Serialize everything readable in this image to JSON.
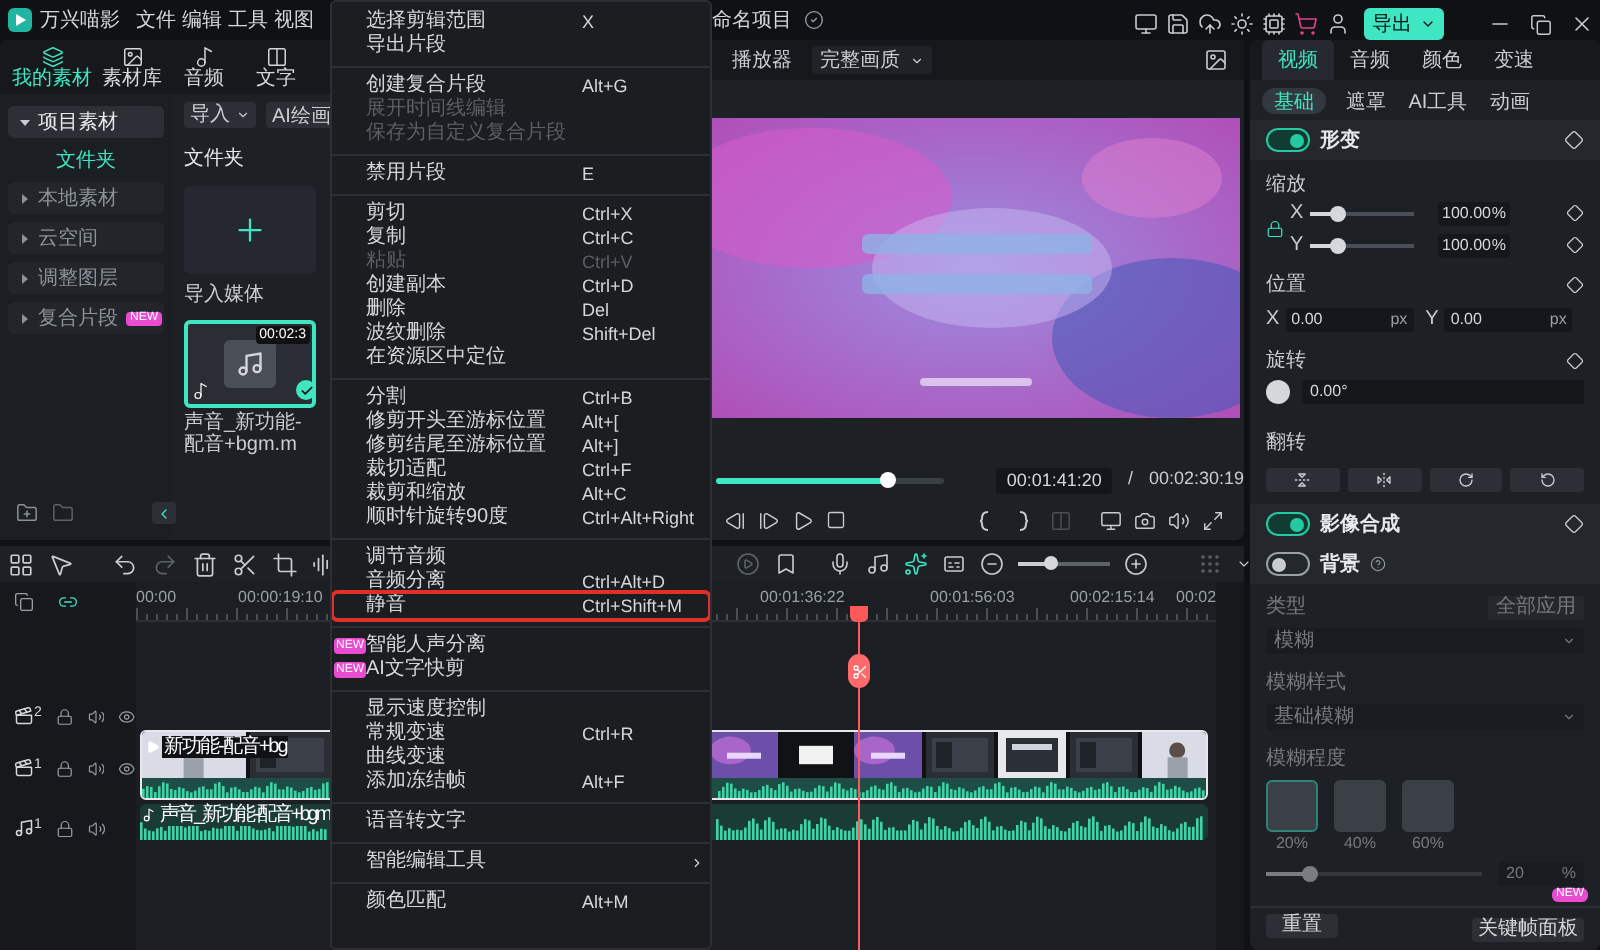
{
  "title_bar": {
    "app_name": "万兴喵影",
    "menus": [
      "文件",
      "编辑",
      "工具",
      "视图"
    ],
    "project_name": "命名项目",
    "export_button": "导出"
  },
  "media_panel": {
    "tabs": [
      {
        "label": "我的素材",
        "selected": true
      },
      {
        "label": "素材库",
        "selected": false
      },
      {
        "label": "音频",
        "selected": false
      },
      {
        "label": "文字",
        "selected": false
      }
    ],
    "sidebar": [
      {
        "label": "项目素材",
        "selected": true,
        "expanded": true,
        "children": [
          {
            "label": "文件夹",
            "selected": true
          }
        ]
      },
      {
        "label": "本地素材",
        "selected": false,
        "expanded": false
      },
      {
        "label": "云空间",
        "selected": false,
        "expanded": false
      },
      {
        "label": "调整图层",
        "selected": false,
        "expanded": false
      },
      {
        "label": "复合片段",
        "selected": false,
        "expanded": false,
        "badge": "NEW"
      }
    ],
    "import_button": "导入",
    "ai_paint_button": "AI绘画",
    "folder_title": "文件夹",
    "import_tile": "导入媒体",
    "clip": {
      "duration": "00:02:3",
      "name": "声音_新功能-配音+bgm.m"
    }
  },
  "player": {
    "label": "播放器",
    "quality": "完整画质",
    "progress": {
      "level": 0.75
    },
    "current_time": "00:01:41:20",
    "divider": "/",
    "total_time": "00:02:30:19"
  },
  "context_menu": {
    "items": [
      {
        "kind": "item",
        "label": "选择剪辑范围",
        "shortcut": "X",
        "disabled": false,
        "selected": false,
        "submenu": false
      },
      {
        "kind": "item",
        "label": "导出片段",
        "disabled": false,
        "selected": false,
        "submenu": false
      },
      {
        "kind": "separator"
      },
      {
        "kind": "item",
        "label": "创建复合片段",
        "shortcut": "Alt+G",
        "disabled": false,
        "selected": false,
        "submenu": false
      },
      {
        "kind": "item",
        "label": "展开时间线编辑",
        "disabled": true,
        "selected": false,
        "submenu": false
      },
      {
        "kind": "item",
        "label": "保存为自定义复合片段",
        "disabled": true,
        "selected": false,
        "submenu": false
      },
      {
        "kind": "separator"
      },
      {
        "kind": "item",
        "label": "禁用片段",
        "shortcut": "E",
        "disabled": false,
        "selected": false,
        "submenu": false
      },
      {
        "kind": "separator"
      },
      {
        "kind": "item",
        "label": "剪切",
        "shortcut": "Ctrl+X",
        "disabled": false,
        "selected": false,
        "submenu": false
      },
      {
        "kind": "item",
        "label": "复制",
        "shortcut": "Ctrl+C",
        "disabled": false,
        "selected": false,
        "submenu": false
      },
      {
        "kind": "item",
        "label": "粘贴",
        "shortcut": "Ctrl+V",
        "disabled": true,
        "selected": false,
        "submenu": false
      },
      {
        "kind": "item",
        "label": "创建副本",
        "shortcut": "Ctrl+D",
        "disabled": false,
        "selected": false,
        "submenu": false
      },
      {
        "kind": "item",
        "label": "删除",
        "shortcut": "Del",
        "disabled": false,
        "selected": false,
        "submenu": false
      },
      {
        "kind": "item",
        "label": "波纹删除",
        "shortcut": "Shift+Del",
        "disabled": false,
        "selected": false,
        "submenu": false
      },
      {
        "kind": "item",
        "label": "在资源区中定位",
        "disabled": false,
        "selected": false,
        "submenu": false
      },
      {
        "kind": "separator"
      },
      {
        "kind": "item",
        "label": "分割",
        "shortcut": "Ctrl+B",
        "disabled": false,
        "selected": false,
        "submenu": false
      },
      {
        "kind": "item",
        "label": "修剪开头至游标位置",
        "shortcut": "Alt+[",
        "disabled": false,
        "selected": false,
        "submenu": false
      },
      {
        "kind": "item",
        "label": "修剪结尾至游标位置",
        "shortcut": "Alt+]",
        "disabled": false,
        "selected": false,
        "submenu": false
      },
      {
        "kind": "item",
        "label": "裁切适配",
        "shortcut": "Ctrl+F",
        "disabled": false,
        "selected": false,
        "submenu": false
      },
      {
        "kind": "item",
        "label": "裁剪和缩放",
        "shortcut": "Alt+C",
        "disabled": false,
        "selected": false,
        "submenu": false
      },
      {
        "kind": "item",
        "label": "顺时针旋转90度",
        "shortcut": "Ctrl+Alt+Right",
        "disabled": false,
        "selected": false,
        "submenu": false
      },
      {
        "kind": "separator"
      },
      {
        "kind": "item",
        "label": "调节音频",
        "disabled": false,
        "selected": false,
        "submenu": false
      },
      {
        "kind": "item",
        "label": "音频分离",
        "shortcut": "Ctrl+Alt+D",
        "disabled": false,
        "selected": false,
        "submenu": false
      },
      {
        "kind": "item",
        "label": "静音",
        "shortcut": "Ctrl+Shift+M",
        "disabled": false,
        "selected": true,
        "submenu": false
      },
      {
        "kind": "separator"
      },
      {
        "kind": "item",
        "label": "智能人声分离",
        "badge": "NEW",
        "disabled": false,
        "selected": false,
        "submenu": false
      },
      {
        "kind": "item",
        "label": "AI文字快剪",
        "badge": "NEW",
        "disabled": false,
        "selected": false,
        "submenu": false
      },
      {
        "kind": "separator"
      },
      {
        "kind": "item",
        "label": "显示速度控制",
        "disabled": false,
        "selected": false,
        "submenu": false
      },
      {
        "kind": "item",
        "label": "常规变速",
        "shortcut": "Ctrl+R",
        "disabled": false,
        "selected": false,
        "submenu": false
      },
      {
        "kind": "item",
        "label": "曲线变速",
        "disabled": false,
        "selected": false,
        "submenu": false
      },
      {
        "kind": "item",
        "label": "添加冻结帧",
        "shortcut": "Alt+F",
        "disabled": false,
        "selected": false,
        "submenu": false
      },
      {
        "kind": "separator"
      },
      {
        "kind": "item",
        "label": "语音转文字",
        "disabled": false,
        "selected": false,
        "submenu": false
      },
      {
        "kind": "separator"
      },
      {
        "kind": "item",
        "label": "智能编辑工具",
        "disabled": false,
        "selected": false,
        "submenu": true
      },
      {
        "kind": "separator"
      },
      {
        "kind": "item",
        "label": "颜色匹配",
        "shortcut": "Alt+M",
        "disabled": false,
        "selected": false,
        "submenu": false
      }
    ]
  },
  "timeline": {
    "ruler": [
      "00:00",
      "00:00:19:10",
      "00:01:36:22",
      "00:01:56:03",
      "00:02:15:14",
      "00:02"
    ],
    "zoom": {
      "level": 0.35
    },
    "tracks": [
      {
        "kind": "video",
        "number": "2"
      },
      {
        "kind": "video",
        "number": "1",
        "clip": "新功能-配音+bg"
      },
      {
        "kind": "audio",
        "number": "1",
        "clip": "声音_新功能-配音+bgm"
      }
    ]
  },
  "properties": {
    "tabs": [
      {
        "label": "视频",
        "selected": true
      },
      {
        "label": "音频",
        "selected": false
      },
      {
        "label": "颜色",
        "selected": false
      },
      {
        "label": "变速",
        "selected": false
      }
    ],
    "subtabs": [
      {
        "label": "基础",
        "selected": true
      },
      {
        "label": "遮罩",
        "selected": false
      },
      {
        "label": "AI工具",
        "selected": false
      },
      {
        "label": "动画",
        "selected": false
      }
    ],
    "transform": {
      "title": "形变",
      "on": true,
      "scale_label": "缩放",
      "scale": [
        {
          "axis": "X",
          "level": 0.27,
          "value": "100.00",
          "unit": "%"
        },
        {
          "axis": "Y",
          "level": 0.27,
          "value": "100.00",
          "unit": "%"
        }
      ],
      "position_label": "位置",
      "position": [
        {
          "axis": "X",
          "value": "0.00",
          "unit": "px"
        },
        {
          "axis": "Y",
          "value": "0.00",
          "unit": "px"
        }
      ],
      "rotation_label": "旋转",
      "rotation": "0.00°",
      "flip_label": "翻转"
    },
    "compositing": {
      "title": "影像合成",
      "on": true
    },
    "background": {
      "title": "背景",
      "on": false,
      "type_label": "类型",
      "apply_all": "全部应用",
      "type_value": "模糊",
      "style_label": "模糊样式",
      "style_value": "基础模糊",
      "degree_label": "模糊程度",
      "presets": [
        {
          "label": "20%",
          "selected": true
        },
        {
          "label": "40%",
          "selected": false
        },
        {
          "label": "60%",
          "selected": false
        }
      ],
      "slider": {
        "level": 0.2
      },
      "value": "20",
      "unit": "%"
    },
    "reset_button": "重置",
    "keyframe_button": "关键帧面板",
    "keyframe_badge": "NEW"
  }
}
